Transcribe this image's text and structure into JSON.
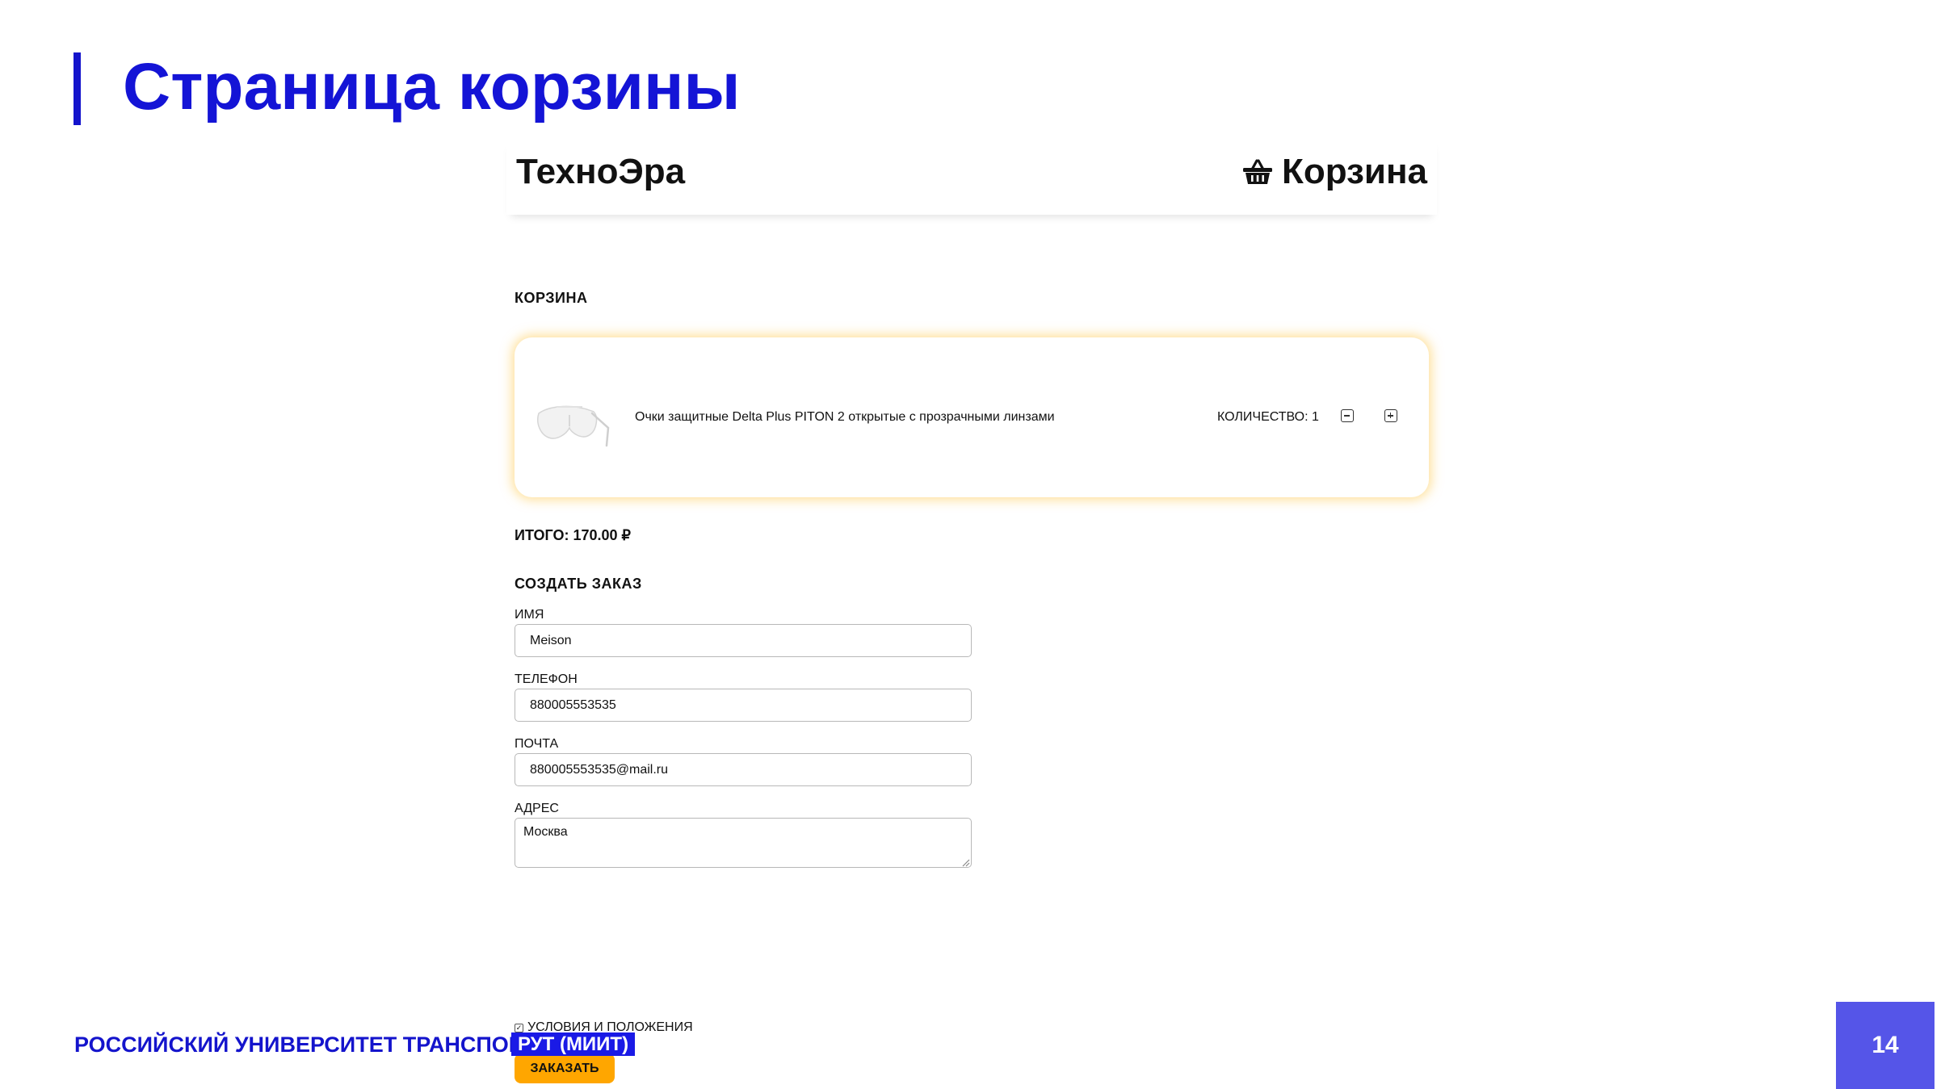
{
  "slide": {
    "title": "Страница корзины",
    "footer_org": "РОССИЙСКИЙ УНИВЕРСИТЕТ ТРАНСПОРТА",
    "footer_badge": "РУТ (МИИТ)",
    "page_number": "14"
  },
  "site": {
    "brand": "ТехноЭра",
    "cart_link_label": "Корзина",
    "cart_icon": "basket-icon"
  },
  "cart": {
    "title": "КОРЗИНА",
    "items": [
      {
        "name": "Очки защитные Delta Plus PITON 2 открытые с прозрачными линзами",
        "quantity_label": "КОЛИЧЕСТВО: 1",
        "image_icon": "safety-glasses-image"
      }
    ],
    "total": "ИТОГО: 170.00 ₽"
  },
  "order_form": {
    "title": "СОЗДАТЬ ЗАКАЗ",
    "name_label": "ИМЯ",
    "name_value": "Meison",
    "phone_label": "ТЕЛЕФОН",
    "phone_value": "880005553535",
    "email_label": "ПОЧТА",
    "email_value": "880005553535@mail.ru",
    "address_label": "АДРЕС",
    "address_value": "Москва",
    "terms_label": "УСЛОВИЯ И ПОЛОЖЕНИЯ",
    "terms_checked": true,
    "submit_label": "ЗАКАЗАТЬ"
  },
  "colors": {
    "slide_accent": "#1414cc",
    "button": "#ffa600",
    "card_glow": "#ffc440",
    "page_badge": "#5555e8"
  }
}
